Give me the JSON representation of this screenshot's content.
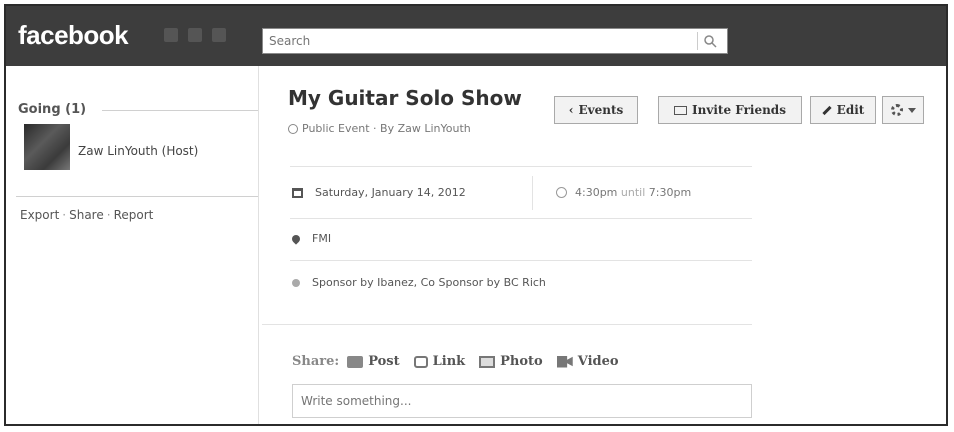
{
  "header": {
    "logo": "facebook",
    "search_placeholder": "Search"
  },
  "event": {
    "title": "My Guitar Solo Show",
    "subtitle": "Public Event · By Zaw LinYouth",
    "date": "Saturday, January 14, 2012",
    "time_start": "4:30pm",
    "time_until": "until",
    "time_end": "7:30pm",
    "location": "FMI",
    "description": "Sponsor by Ibanez, Co Sponsor by BC Rich"
  },
  "actions": {
    "events_label": "Events",
    "invite_label": "Invite Friends",
    "edit_label": "Edit"
  },
  "sidebar": {
    "going_label": "Going (1)",
    "host_name": "Zaw LinYouth (Host)",
    "links": {
      "export": "Export",
      "share": "Share",
      "report": "Report",
      "sep": "·"
    }
  },
  "composer": {
    "share_label": "Share:",
    "post": "Post",
    "link": "Link",
    "photo": "Photo",
    "video": "Video",
    "placeholder": "Write something..."
  },
  "colors": {
    "topbar": "#3d3d3d",
    "logo": "#ffffff",
    "button_bg": "#f2f2f2",
    "border": "#a9a9a9"
  }
}
